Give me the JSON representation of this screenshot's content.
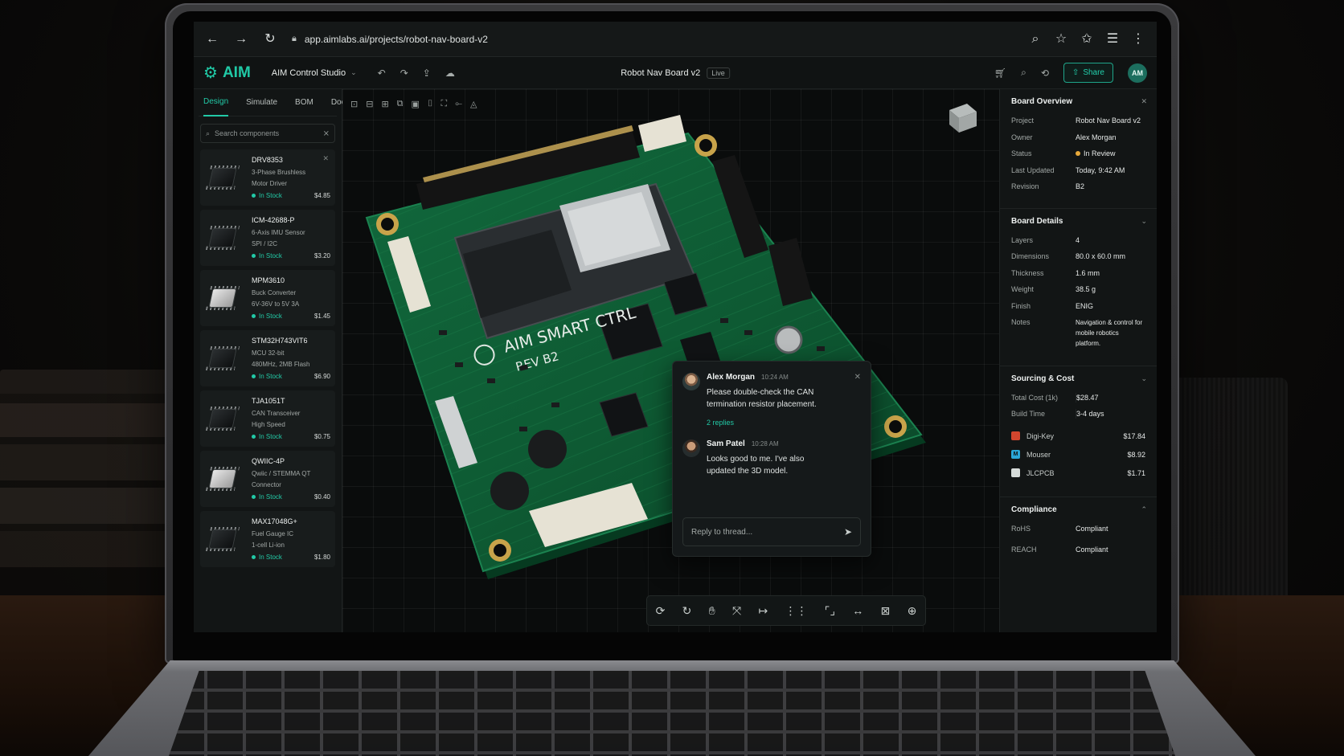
{
  "browser": {
    "url": "app.aimlabs.ai/projects/robot-nav-board-v2"
  },
  "header": {
    "logo_text": "AIM",
    "studio": "AIM Control Studio",
    "doc_title": "Robot Nav Board v2",
    "live_badge": "Live",
    "share_label": "Share",
    "avatar_initials": "AM"
  },
  "left": {
    "tabs": [
      {
        "label": "Design"
      },
      {
        "label": "Simulate"
      },
      {
        "label": "BOM"
      },
      {
        "label": "Docs"
      }
    ],
    "search_placeholder": "Search components",
    "components": [
      {
        "name": "DRV8353",
        "desc1": "3-Phase Brushless",
        "desc2": "Motor Driver",
        "stock": "In Stock",
        "price": "$4.85"
      },
      {
        "name": "ICM-42688-P",
        "desc1": "6-Axis IMU Sensor",
        "desc2": "SPI / I2C",
        "stock": "In Stock",
        "price": "$3.20"
      },
      {
        "name": "MPM3610",
        "desc1": "Buck Converter",
        "desc2": "6V-36V to 5V 3A",
        "stock": "In Stock",
        "price": "$1.45"
      },
      {
        "name": "STM32H743VIT6",
        "desc1": "MCU 32-bit",
        "desc2": "480MHz, 2MB Flash",
        "stock": "In Stock",
        "price": "$6.90"
      },
      {
        "name": "TJA1051T",
        "desc1": "CAN Transceiver",
        "desc2": "High Speed",
        "stock": "In Stock",
        "price": "$0.75"
      },
      {
        "name": "QWIIC-4P",
        "desc1": "Qwiic / STEMMA QT",
        "desc2": "Connector",
        "stock": "In Stock",
        "price": "$0.40"
      },
      {
        "name": "MAX17048G+",
        "desc1": "Fuel Gauge IC",
        "desc2": "1-cell Li-ion",
        "stock": "In Stock",
        "price": "$1.80"
      }
    ]
  },
  "board": {
    "silk_title": "AIM SMART CTRL",
    "silk_rev": "REV B2"
  },
  "thread": {
    "messages": [
      {
        "author": "Alex Morgan",
        "time": "10:24 AM",
        "text1": "Please double-check the CAN",
        "text2": "termination resistor placement.",
        "replies": "2 replies"
      },
      {
        "author": "Sam Patel",
        "time": "10:28 AM",
        "text1": "Looks good to me. I've also",
        "text2": "updated the 3D model."
      }
    ],
    "reply_placeholder": "Reply to thread..."
  },
  "right": {
    "overview": {
      "title": "Board Overview",
      "rows": [
        {
          "k": "Project",
          "v": "Robot Nav Board v2"
        },
        {
          "k": "Owner",
          "v": "Alex Morgan"
        },
        {
          "k": "Status",
          "v": "In Review"
        },
        {
          "k": "Last Updated",
          "v": "Today, 9:42 AM"
        },
        {
          "k": "Revision",
          "v": "B2"
        }
      ]
    },
    "details": {
      "title": "Board Details",
      "rows": [
        {
          "k": "Layers",
          "v": "4"
        },
        {
          "k": "Dimensions",
          "v": "80.0 x 60.0 mm"
        },
        {
          "k": "Thickness",
          "v": "1.6 mm"
        },
        {
          "k": "Weight",
          "v": "38.5 g"
        },
        {
          "k": "Finish",
          "v": "ENIG"
        }
      ],
      "notes_label": "Notes",
      "notes1": "Navigation & control for",
      "notes2": "mobile robotics platform."
    },
    "sourcing": {
      "title": "Sourcing & Cost",
      "total_label": "Total Cost (1k)",
      "total": "$28.47",
      "build_label": "Build Time",
      "build": "3-4 days",
      "vendors": [
        {
          "name": "Digi-Key",
          "price": "$17.84",
          "color": "#d2462e"
        },
        {
          "name": "Mouser",
          "price": "$8.92",
          "color": "#2aa7d8"
        },
        {
          "name": "JLCPCB",
          "price": "$1.71",
          "color": "#d6dbd9"
        }
      ]
    },
    "compliance": {
      "title": "Compliance",
      "rows": [
        {
          "k": "RoHS",
          "v": "Compliant"
        },
        {
          "k": "REACH",
          "v": "Compliant"
        }
      ]
    }
  },
  "colors": {
    "accent": "#22c9a6",
    "pcb": "#0f5a34",
    "status_review": "#e7a93a"
  }
}
